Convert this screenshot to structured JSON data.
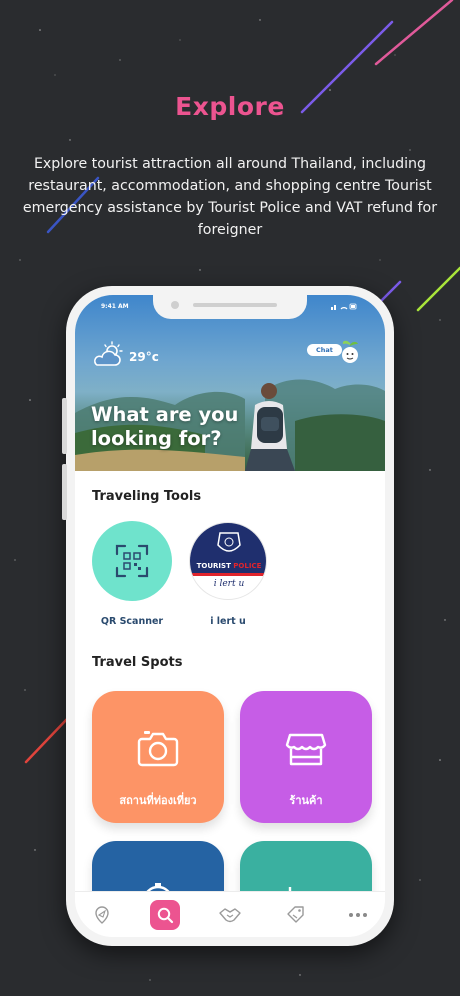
{
  "promo": {
    "title": "Explore",
    "description": "Explore tourist attraction all around Thailand, including restaurant, accommodation, and shopping centre Tourist emergency assistance by Tourist Police and VAT refund for foreigner"
  },
  "status_bar": {
    "time": "9:41 AM",
    "icons": "signal-wifi-battery"
  },
  "hero": {
    "weather_icon": "partly-cloudy-icon",
    "temperature": "29°c",
    "chat_label": "Chat",
    "mascot_icon": "mascot-icon",
    "headline_line1": "What are you",
    "headline_line2": "looking for?"
  },
  "traveling_tools": {
    "title": "Traveling Tools",
    "items": [
      {
        "label": "QR Scanner",
        "icon": "qr-scanner-icon",
        "color": "#6fe3cc"
      },
      {
        "label": "i lert u",
        "icon": "tourist-police-badge",
        "badge_text_white": "TOURIST",
        "badge_text_red": "POLICE",
        "badge_script": "i lert u"
      }
    ]
  },
  "travel_spots": {
    "title": "Travel Spots",
    "items": [
      {
        "label": "สถานที่ท่องเที่ยว",
        "icon": "camera-icon",
        "color": "#fd9466"
      },
      {
        "label": "ร้านค้า",
        "icon": "store-icon",
        "color": "#c65de6"
      },
      {
        "label": "",
        "icon": "compass-icon",
        "color": "#2563a3"
      },
      {
        "label": "",
        "icon": "bed-icon",
        "color": "#3ab0a0"
      }
    ]
  },
  "tab_bar": {
    "items": [
      {
        "icon": "map-pin-icon",
        "active": false
      },
      {
        "icon": "search-icon",
        "active": true
      },
      {
        "icon": "handshake-icon",
        "active": false
      },
      {
        "icon": "tag-icon",
        "active": false
      },
      {
        "icon": "more-icon",
        "active": false
      }
    ],
    "accent": "#ec5490"
  }
}
